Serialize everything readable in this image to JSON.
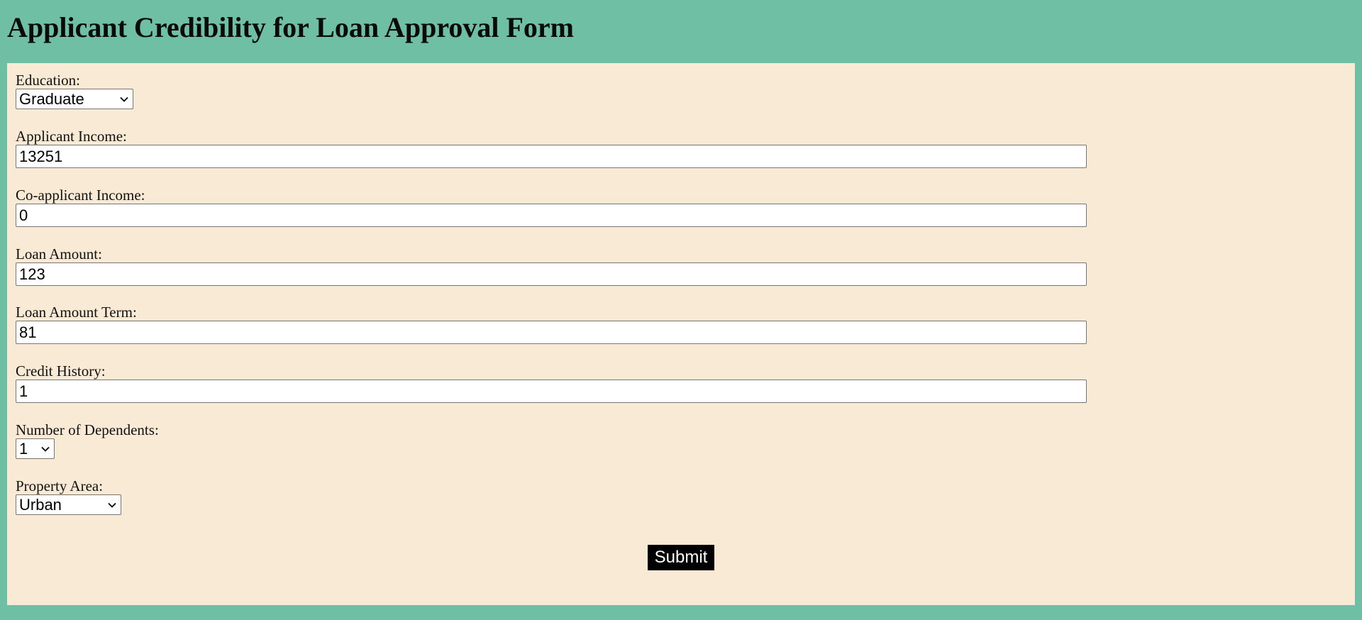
{
  "page": {
    "title": "Applicant Credibility for Loan Approval Form"
  },
  "form": {
    "education": {
      "label": "Education:",
      "value": "Graduate"
    },
    "applicant_income": {
      "label": "Applicant Income:",
      "value": "13251"
    },
    "coapplicant_income": {
      "label": "Co-applicant Income:",
      "value": "0"
    },
    "loan_amount": {
      "label": "Loan Amount:",
      "value": "123"
    },
    "loan_amount_term": {
      "label": "Loan Amount Term:",
      "value": "81"
    },
    "credit_history": {
      "label": "Credit History:",
      "value": "1"
    },
    "dependents": {
      "label": "Number of Dependents:",
      "value": "1"
    },
    "property_area": {
      "label": "Property Area:",
      "value": "Urban"
    },
    "submit_label": "Submit"
  },
  "colors": {
    "page_background": "#6ebfa3",
    "panel_background": "#f9ead6",
    "button_background": "#000000"
  }
}
